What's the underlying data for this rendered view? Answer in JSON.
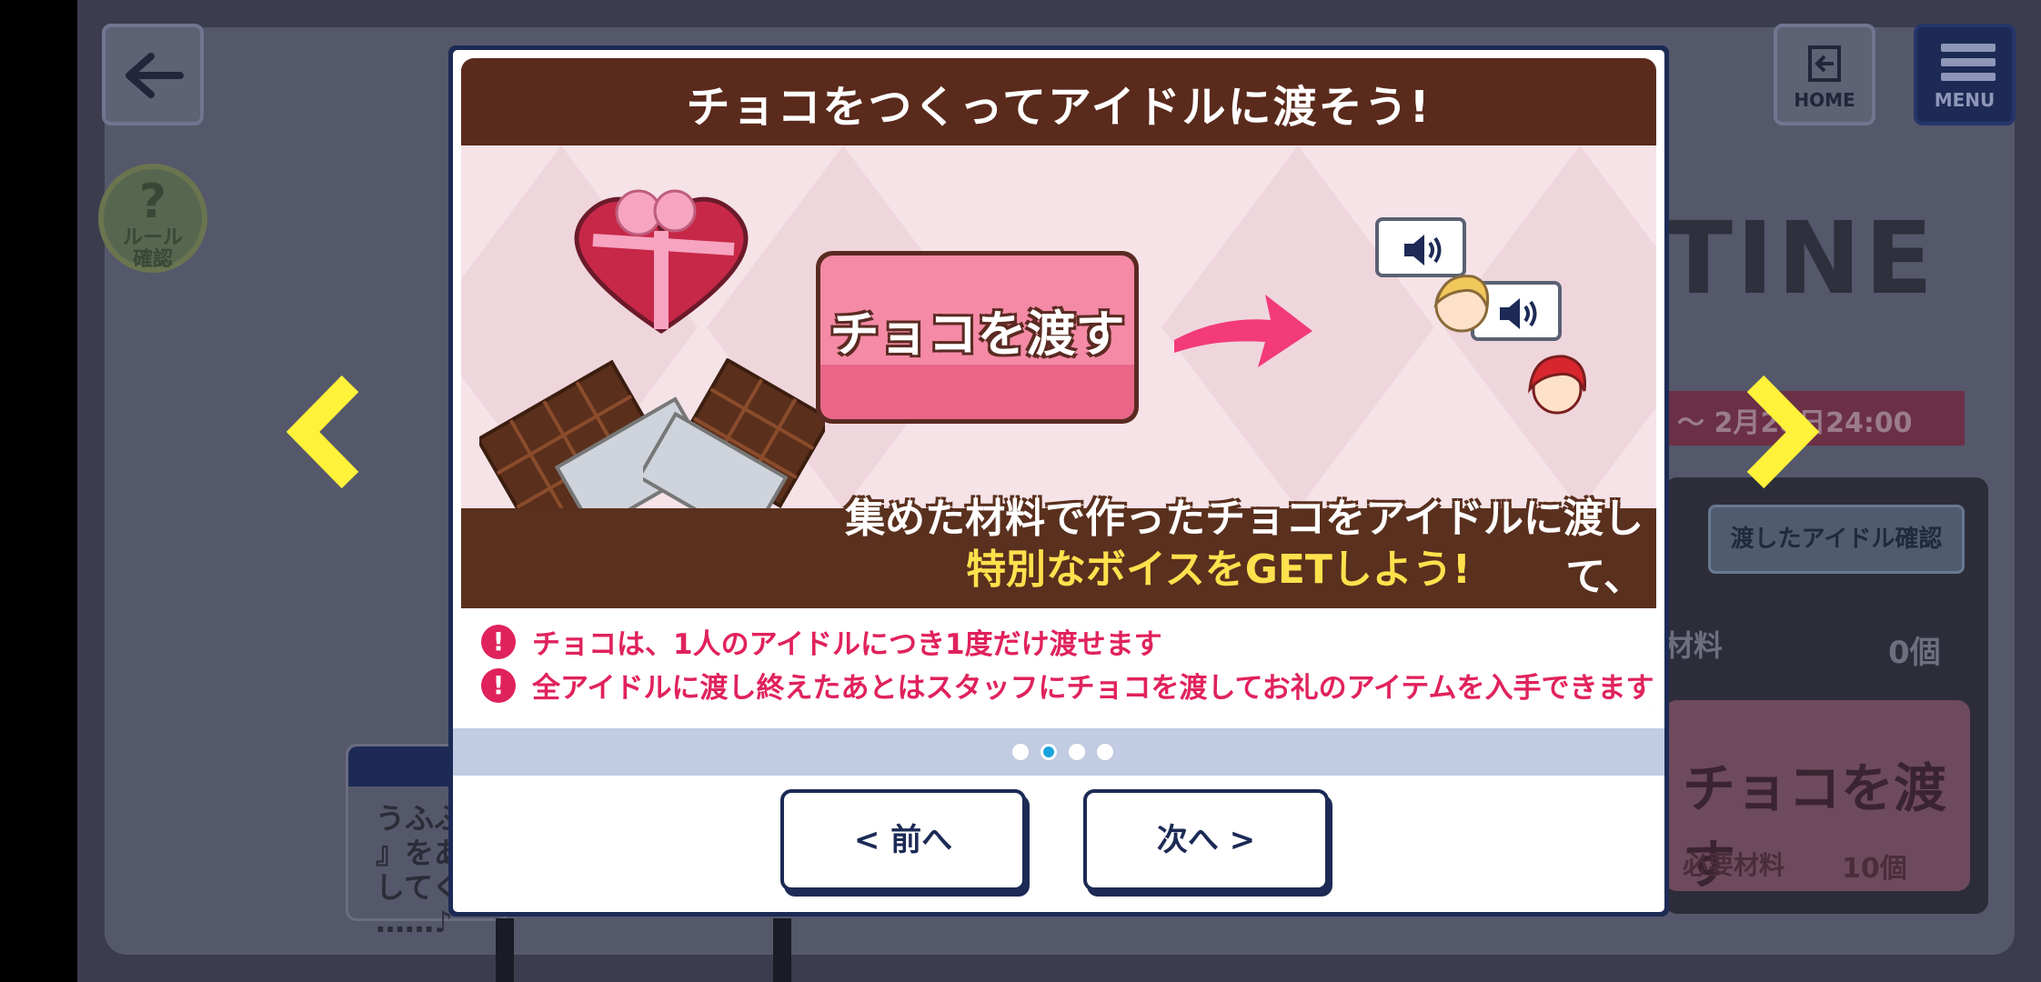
{
  "background": {
    "rule_button": {
      "mark": "?",
      "label": "ルール\n確認"
    },
    "home_label": "HOME",
    "menu_label": "MENU",
    "event_title_partial": "TINE",
    "event_period_partial": "〜 2月28日24:00",
    "given_idols_button": "渡したアイドル確認",
    "material_label": "材料",
    "material_count": "0個",
    "give_label": "チョコを渡す",
    "required_label": "必要材料",
    "required_count": "10個",
    "dialog_text": "うふふ\n』をあ\nしてく\n……♪"
  },
  "modal": {
    "title": "チョコをつくってアイドルに渡そう!",
    "give_button_art": "チョコを渡す",
    "description_line1": "集めた材料で作ったチョコをアイドルに渡して、",
    "description_line2": "特別なボイスをGETしよう!",
    "notes": [
      "チョコは、1人のアイドルにつき1度だけ渡せます",
      "全アイドルに渡し終えたあとはスタッフにチョコを渡してお礼のアイテムを入手できます"
    ],
    "pagination": {
      "total": 4,
      "current": 2
    },
    "prev_button": "< 前へ",
    "next_button": "次へ >"
  },
  "colors": {
    "header_brown": "#5a2a1c",
    "accent_pink": "#e0225c",
    "highlight_yellow": "#ffe14d",
    "navy": "#1c2a55",
    "arrow_yellow": "#fff23a"
  },
  "icons": [
    "back-arrow-icon",
    "home-exit-icon",
    "menu-icon",
    "question-icon",
    "left-arrow-icon",
    "right-arrow-icon",
    "speaker-icon",
    "exclamation-icon"
  ]
}
